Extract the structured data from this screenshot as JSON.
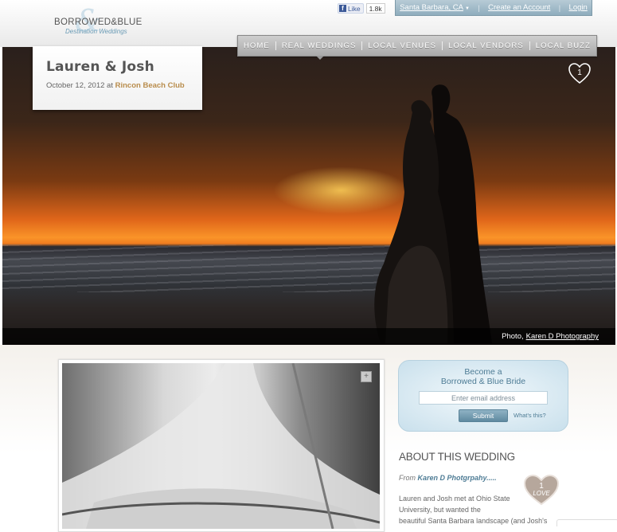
{
  "brand": {
    "name": "BORROWED&BLUE",
    "tagline": "Destination Weddings"
  },
  "facebook": {
    "like_label": "Like",
    "count": "1.8k"
  },
  "userbar": {
    "location": "Santa Barbara, CA",
    "create_account": "Create an Account",
    "login": "Login"
  },
  "nav": {
    "items": [
      "HOME",
      "REAL WEDDINGS",
      "LOCAL VENUES",
      "LOCAL VENDORS",
      "LOCAL BUZZ"
    ]
  },
  "wedding": {
    "title": "Lauren & Josh",
    "date": "October 12, 2012 at ",
    "venue": "Rincon Beach Club",
    "loves": "1"
  },
  "hero": {
    "credit_prefix": "Photo,",
    "credit_name": "Karen D Photography"
  },
  "gallery": {
    "expand_symbol": "+"
  },
  "signup": {
    "line1": "Become a",
    "line2": "Borrowed & Blue Bride",
    "email_placeholder": "Enter email address",
    "submit": "Submit",
    "whats_this": "What's this?"
  },
  "about": {
    "heading": "ABOUT THIS WEDDING",
    "from_prefix": "From ",
    "from_name": "Karen D Photgrpahy.....",
    "love_count": "1",
    "love_label": "LOVE",
    "line1": "Lauren and Josh met at Ohio State",
    "line2": "University, but wanted the",
    "line3": "beautiful Santa Barbara landscape (and Josh's"
  },
  "colors": {
    "accent_blue": "#4e7c95",
    "venue_gold": "#b98d4d",
    "nav_gray": "#a9a9a9"
  }
}
